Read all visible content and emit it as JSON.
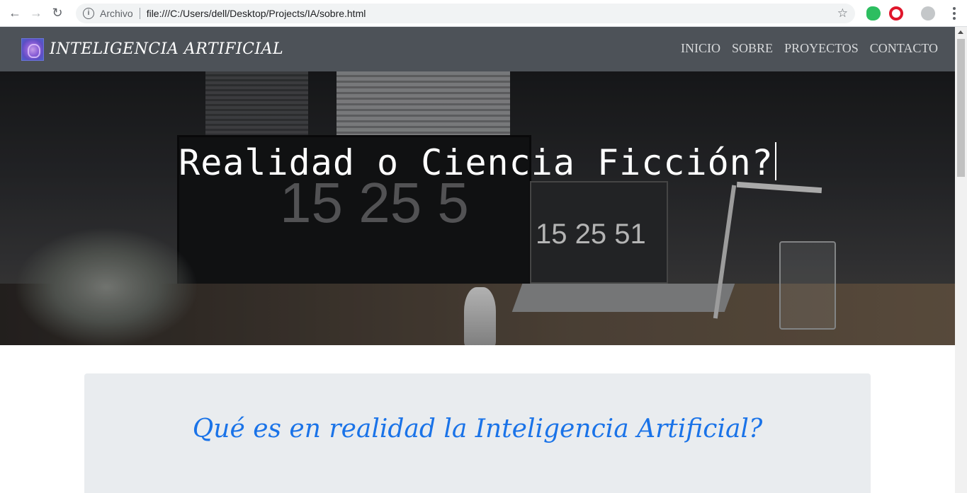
{
  "browser": {
    "scheme_label": "Archivo",
    "url": "file:///C:/Users/dell/Desktop/Projects/IA/sobre.html"
  },
  "navbar": {
    "brand": "INTELIGENCIA ARTIFICIAL",
    "links": [
      "INICIO",
      "SOBRE",
      "PROYECTOS",
      "CONTACTO"
    ]
  },
  "hero": {
    "title": "Realidad o Ciencia Ficción?",
    "clock_monitor": "15 25 5",
    "clock_laptop": "15 25 51"
  },
  "section": {
    "title": "Qué es en realidad la Inteligencia Artificial?"
  },
  "colors": {
    "navbar_bg": "#4d5258",
    "card_bg": "#e9ecef",
    "heading_blue": "#1a73e8"
  }
}
